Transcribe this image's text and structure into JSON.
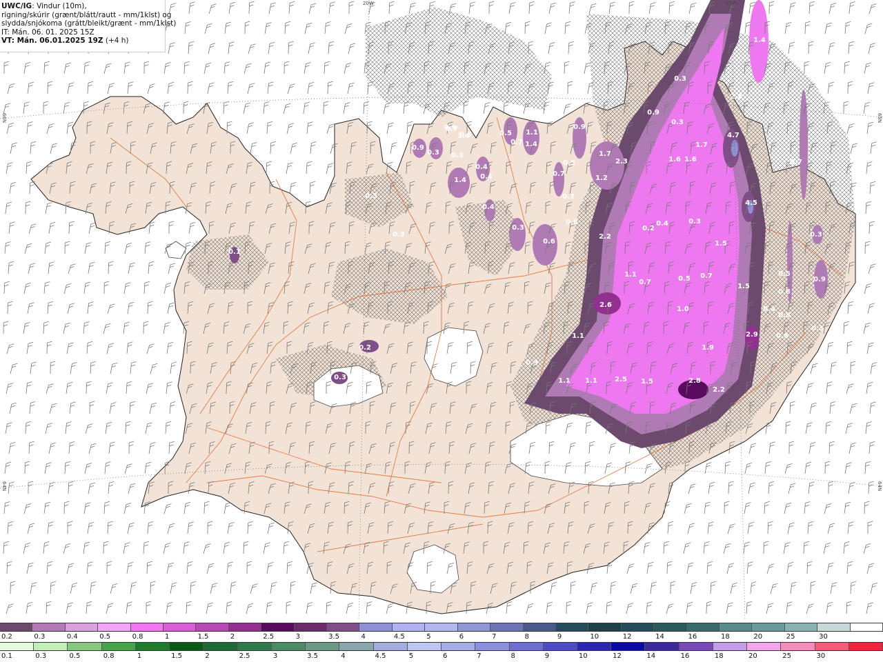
{
  "info_box": {
    "line1_bold": "UWC/IG",
    "line1_rest": ": Vindur (10m),",
    "line2": "rigning/skúrir (grænt/blátt/rautt - mm/1klst) og",
    "line3": "slydda/snjókoma (grátt/bleikt/grænt - mm/1klst)",
    "line4": "IT: Mán. 06. 01. 2025 15Z",
    "line5_bold": "VT: Mán. 06.01.2025 19Z",
    "line5_rest": " (+4 h)"
  },
  "graticule_labels": {
    "top_20w": "20W",
    "top_15w": "15W",
    "left_66n": "66N",
    "right_65n": "65N",
    "left_64n": "64N",
    "right_64n": "64N"
  },
  "precip_values": [
    "0.9",
    "0.3",
    "0.7",
    "1.4",
    "0.5",
    "0.7",
    "1.1",
    "1.4",
    "0.4",
    "1.4",
    "0.4",
    "0.4",
    "0.3",
    "0.9",
    "0.5",
    "0.7",
    "0.3",
    "0.6",
    "0.3",
    "0.6",
    "1.7",
    "2.3",
    "1.2",
    "0.9",
    "1.6",
    "1.6",
    "1.7",
    "4.7",
    "2.2",
    "1.4",
    "4.5",
    "0.7",
    "0.3",
    "0.2",
    "0.4",
    "0.3",
    "0.5",
    "0.6",
    "2.2",
    "1.1",
    "0.7",
    "0.5",
    "0.7",
    "1.5",
    "1.5",
    "0.3",
    "0.9",
    "0.8",
    "0.8",
    "0.6",
    "0.4",
    "2.6",
    "1.0",
    "2.9",
    "1.1",
    "1.9",
    "0.3",
    "1.1",
    "1.1",
    "2.5",
    "1.5",
    "2.8",
    "2.2",
    "0.3",
    "0.3",
    "0.9",
    "0.3",
    "0.3",
    "0.1",
    "0.2",
    "0.3",
    "0.3"
  ],
  "legend_snow": {
    "labels": [
      "0.2",
      "0.3",
      "0.4",
      "0.5",
      "0.8",
      "1",
      "1.5",
      "2",
      "2.5",
      "3",
      "3.5",
      "4",
      "4.5",
      "5",
      "6",
      "7",
      "8",
      "9",
      "10",
      "12",
      "14",
      "16",
      "18",
      "20",
      "25",
      "30"
    ],
    "colors": [
      "#6b4a6e",
      "#b07bb4",
      "#d8a3dc",
      "#f3a6f5",
      "#ee78ef",
      "#d460d4",
      "#b64ab4",
      "#922f8f",
      "#5a0a5c",
      "#6a2b6a",
      "#7e4e88",
      "#9090d6",
      "#b0b0f2",
      "#b2b8ef",
      "#8f97d4",
      "#6c74b6",
      "#485a8c",
      "#244c5a",
      "#1f3f49",
      "#244c5a",
      "#2b5a5a",
      "#3a6a6a",
      "#5a8a8a",
      "#6a9a9a",
      "#8ab0b0",
      "#c8d8d8",
      "#ffffff"
    ]
  },
  "legend_rain": {
    "labels": [
      "0.1",
      "0.3",
      "0.5",
      "0.8",
      "1",
      "1.5",
      "2",
      "2.5",
      "3",
      "3.5",
      "4",
      "4.5",
      "5",
      "6",
      "7",
      "8",
      "9",
      "10",
      "12",
      "14",
      "16",
      "18",
      "20",
      "25",
      "30"
    ],
    "colors": [
      "#e6fae0",
      "#c2eeb8",
      "#84c97c",
      "#4aa24a",
      "#1f7a2a",
      "#0b5a14",
      "#1f6a34",
      "#2f7a4a",
      "#4a8a64",
      "#6a9a86",
      "#8aa6ac",
      "#a2aee2",
      "#bec6f4",
      "#a6ace8",
      "#8c90dc",
      "#6e6ed2",
      "#4e4cc4",
      "#2b26b2",
      "#0b0aa4",
      "#3c2a9c",
      "#7a48b8",
      "#c49cea",
      "#f3a6f0",
      "#f48cbc",
      "#f45c7a",
      "#f0243a"
    ]
  }
}
